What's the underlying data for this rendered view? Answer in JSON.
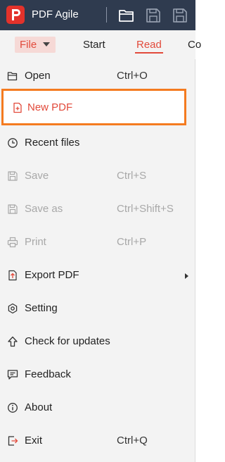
{
  "app": {
    "title": "PDF Agile"
  },
  "toolbar": {
    "icons": [
      "open-folder-icon",
      "save-icon",
      "save-as-icon"
    ]
  },
  "tabs": {
    "file": "File",
    "start": "Start",
    "read": "Read",
    "partial": "Co"
  },
  "menu": {
    "items": [
      {
        "label": "Open",
        "shortcut": "Ctrl+O",
        "icon": "open-icon",
        "enabled": true
      },
      {
        "label": "New PDF",
        "shortcut": "",
        "icon": "new-pdf-icon",
        "enabled": true,
        "highlighted": true
      },
      {
        "label": "Recent files",
        "shortcut": "",
        "icon": "clock-icon",
        "enabled": true
      },
      {
        "label": "Save",
        "shortcut": "Ctrl+S",
        "icon": "save-icon",
        "enabled": false
      },
      {
        "label": "Save as",
        "shortcut": "Ctrl+Shift+S",
        "icon": "save-as-icon",
        "enabled": false
      },
      {
        "label": "Print",
        "shortcut": "Ctrl+P",
        "icon": "print-icon",
        "enabled": false
      },
      {
        "label": "Export PDF",
        "shortcut": "",
        "icon": "export-icon",
        "enabled": true,
        "submenu": true
      },
      {
        "label": "Setting",
        "shortcut": "",
        "icon": "gear-icon",
        "enabled": true
      },
      {
        "label": "Check for updates",
        "shortcut": "",
        "icon": "update-arrow-icon",
        "enabled": true
      },
      {
        "label": "Feedback",
        "shortcut": "",
        "icon": "feedback-icon",
        "enabled": true
      },
      {
        "label": "About",
        "shortcut": "",
        "icon": "info-icon",
        "enabled": true
      },
      {
        "label": "Exit",
        "shortcut": "Ctrl+Q",
        "icon": "exit-icon",
        "enabled": true
      }
    ]
  },
  "colors": {
    "titlebar": "#2f3b4f",
    "accent": "#e24a3b",
    "highlight_border": "#f47b20",
    "menu_bg": "#f3f3f3",
    "disabled_text": "#a8a8a8"
  }
}
